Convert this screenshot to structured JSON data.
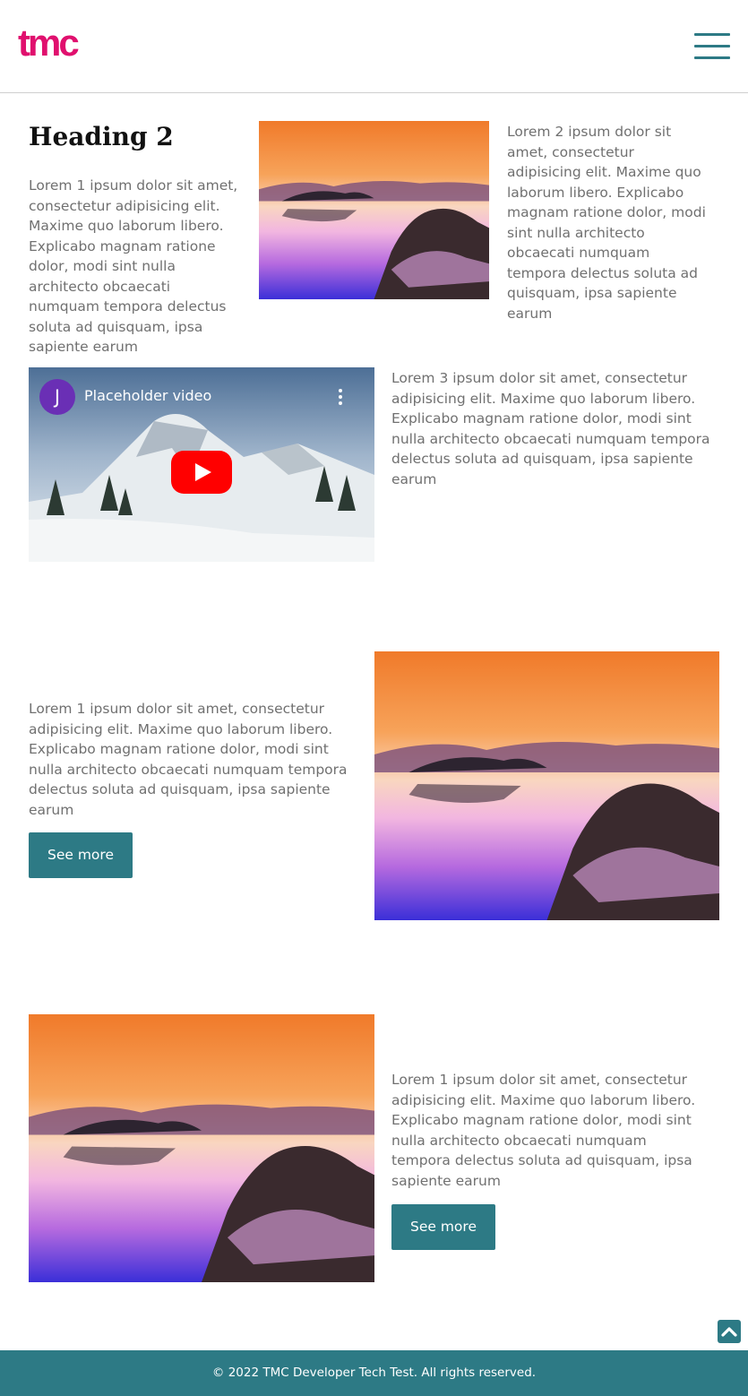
{
  "header": {
    "logo_text": "tmc",
    "menu_icon": "hamburger-menu-icon",
    "brand_color": "#e0106e",
    "accent_color": "#2d7a85"
  },
  "section1": {
    "heading": "Heading 2",
    "text_left": "Lorem 1 ipsum dolor sit amet, consectetur adipisicing elit. Maxime quo laborum libero. Explicabo magnam ratione dolor, modi sint nulla architecto obcaecati numquam tempora delectus soluta ad quisquam, ipsa sapiente earum",
    "text_right": "Lorem 2 ipsum dolor sit amet, consectetur adipisicing elit. Maxime quo laborum libero. Explicabo magnam ratione dolor, modi sint nulla architecto obcaecati numquam tempora delectus soluta ad quisquam, ipsa sapiente earum"
  },
  "video_section": {
    "channel_initial": "J",
    "video_title": "Placeholder video",
    "text": "Lorem 3 ipsum dolor sit amet, consectetur adipisicing elit. Maxime quo laborum libero. Explicabo magnam ratione dolor, modi sint nulla architecto obcaecati numquam tempora delectus soluta ad quisquam, ipsa sapiente earum"
  },
  "feature1": {
    "text": "Lorem 1 ipsum dolor sit amet, consectetur adipisicing elit. Maxime quo laborum libero. Explicabo magnam ratione dolor, modi sint nulla architecto obcaecati numquam tempora delectus soluta ad quisquam, ipsa sapiente earum",
    "button_label": "See more"
  },
  "feature2": {
    "text": "Lorem 1 ipsum dolor sit amet, consectetur adipisicing elit. Maxime quo laborum libero. Explicabo magnam ratione dolor, modi sint nulla architecto obcaecati numquam tempora delectus soluta ad quisquam, ipsa sapiente earum",
    "button_label": "See more"
  },
  "back_to_top_icon": "chevron-up-icon",
  "footer": {
    "copyright": "© 2022 TMC Developer Tech Test. All rights reserved."
  }
}
